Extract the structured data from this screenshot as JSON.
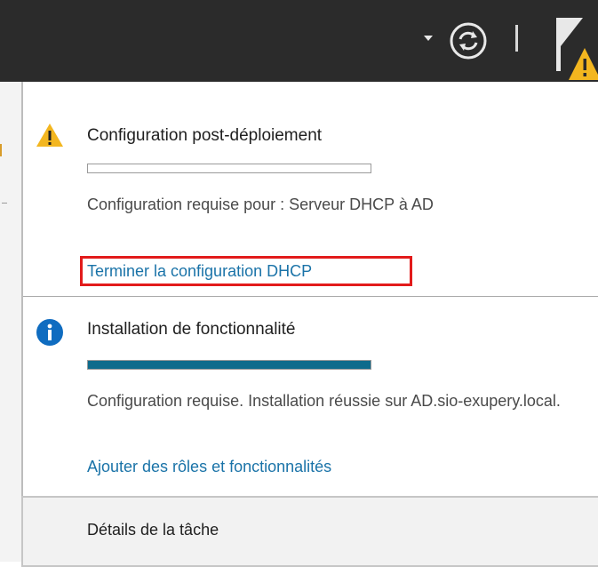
{
  "toolbar": {
    "dropdown_icon": "caret-down-icon",
    "refresh_icon": "refresh-icon",
    "flag_icon": "notification-flag-warning-icon",
    "text_color": "#e8e8e8",
    "background": "#2b2b2b"
  },
  "notifications": [
    {
      "icon": "warning-icon",
      "title": "Configuration post-déploiement",
      "progress_fraction": 0,
      "description": "Configuration requise pour : Serveur DHCP à AD",
      "action_link": "Terminer la configuration DHCP",
      "highlighted": true
    },
    {
      "icon": "info-icon",
      "title": "Installation de fonctionnalité",
      "progress_fraction": 1,
      "description": "Configuration requise. Installation réussie sur AD.sio-exupery.local.",
      "action_link": "Ajouter des rôles et fonctionnalités"
    }
  ],
  "task_details": {
    "label": "Détails de la tâche"
  },
  "colors": {
    "link": "#1a73a8",
    "progress_fill": "#0e6b8c",
    "highlight_border": "#e21b1b",
    "warning": "#f3b61f",
    "info": "#0f6cc0"
  }
}
